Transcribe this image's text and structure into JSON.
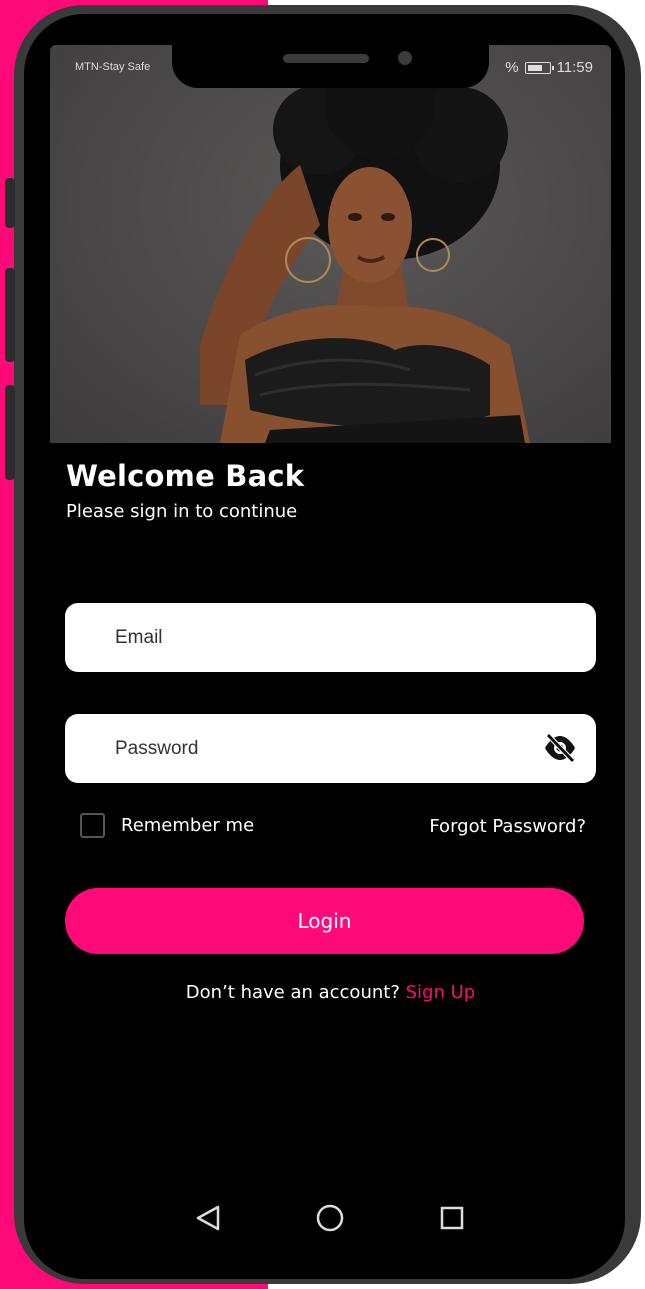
{
  "status_bar": {
    "carrier": "MTN-Stay Safe",
    "battery_prefix": "%",
    "time": "11:59"
  },
  "login": {
    "title": "Welcome Back",
    "subtitle": "Please sign in to continue",
    "email_placeholder": "Email",
    "password_placeholder": "Password",
    "remember_label": "Remember me",
    "remember_checked": false,
    "forgot_label": "Forgot Password?",
    "login_button": "Login",
    "signup_prompt": "Don’t have an account?",
    "signup_link": "Sign Up"
  },
  "icons": {
    "password_toggle": "eye-off-icon",
    "nav_back": "back-triangle-icon",
    "nav_home": "home-circle-icon",
    "nav_recents": "recents-square-icon"
  },
  "colors": {
    "accent": "#ff0a78",
    "screen_background": "#000000",
    "field_background": "#ffffff"
  }
}
